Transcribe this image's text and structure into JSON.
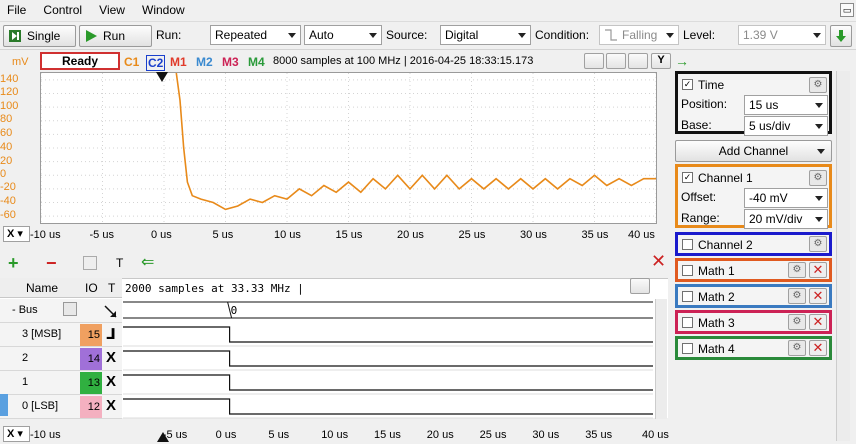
{
  "menu": [
    "File",
    "Control",
    "View",
    "Window"
  ],
  "toolbar": {
    "single_label": "Single",
    "run_label": "Run",
    "run_text": "Run:",
    "run_mode": "Repeated",
    "run_mode2": "Auto",
    "source_text": "Source:",
    "source": "Digital",
    "condition_text": "Condition:",
    "condition": "Falling",
    "level_text": "Level:",
    "level": "1.39 V"
  },
  "scope": {
    "status": "Ready",
    "channels": [
      "C1",
      "C2",
      "M1",
      "M2",
      "M3",
      "M4"
    ],
    "channel_colors": [
      "#e88a1a",
      "#1a3fcc",
      "#e03a2a",
      "#3a8ad0",
      "#cc2255",
      "#2a9a3a"
    ],
    "sample_info": "8000 samples at 100 MHz | 2016-04-25 18:33:15.173",
    "y_unit": "mV",
    "y_ticks": [
      "140",
      "120",
      "100",
      "80",
      "60",
      "40",
      "20",
      "0",
      "-20",
      "-40",
      "-60"
    ],
    "x_ticks": [
      "-10 us",
      "-5 us",
      "0 us",
      "5 us",
      "10 us",
      "15 us",
      "20 us",
      "25 us",
      "30 us",
      "35 us",
      "40 us"
    ],
    "x_selector": "X",
    "y_button": "Y"
  },
  "chart_data": {
    "type": "line",
    "xlabel": "",
    "ylabel": "mV",
    "xlim": [
      -10,
      40
    ],
    "ylim": [
      -70,
      150
    ],
    "series": [
      {
        "x": [
          1.0,
          1.3,
          1.6,
          1.9,
          2.3,
          3,
          4,
          5,
          6,
          7,
          8,
          9,
          10,
          11,
          12,
          13,
          14,
          15,
          16,
          17,
          18,
          19,
          20,
          21,
          22,
          23,
          24,
          25,
          26,
          27,
          28,
          29,
          30,
          31,
          32,
          33,
          34,
          35,
          36,
          37,
          38,
          39,
          40
        ],
        "y": [
          150,
          110,
          40,
          -10,
          -30,
          -35,
          -40,
          -50,
          -45,
          -35,
          -40,
          -30,
          -35,
          -20,
          -30,
          -15,
          -25,
          -10,
          -25,
          -5,
          -20,
          0,
          -20,
          0,
          -20,
          0,
          -20,
          -5,
          -20,
          -5,
          -20,
          -5,
          -20,
          -5,
          -20,
          -5,
          -15,
          0,
          -15,
          -5,
          -15,
          -5,
          -5
        ]
      }
    ]
  },
  "right_panel": {
    "time_label": "Time",
    "position_label": "Position:",
    "position": "15 us",
    "base_label": "Base:",
    "base": "5 us/div",
    "add_channel": "Add Channel",
    "ch1_label": "Channel 1",
    "offset_label": "Offset:",
    "offset": "-40 mV",
    "range_label": "Range:",
    "range": "20 mV/div",
    "ch2_label": "Channel 2",
    "math1": "Math 1",
    "math2": "Math 2",
    "math3": "Math 3",
    "math4": "Math 4"
  },
  "logic": {
    "sample_info": "2000 samples at 33.33 MHz |",
    "col_name": "Name",
    "col_io": "IO",
    "col_t": "T",
    "bus_label": "- Bus",
    "bus_value": "0",
    "rows": [
      {
        "name": "3 [MSB]",
        "io": "15",
        "color": "#f0a060"
      },
      {
        "name": "2",
        "io": "14",
        "color": "#a070d8"
      },
      {
        "name": "1",
        "io": "13",
        "color": "#30b040"
      },
      {
        "name": "0 [LSB]",
        "io": "12",
        "color": "#f4b0c0"
      }
    ],
    "x_ticks": [
      "-10 us",
      "-5 us",
      "0 us",
      "5 us",
      "10 us",
      "15 us",
      "20 us",
      "25 us",
      "30 us",
      "35 us",
      "40 us"
    ],
    "x_selector": "X",
    "t_menu": "T"
  }
}
